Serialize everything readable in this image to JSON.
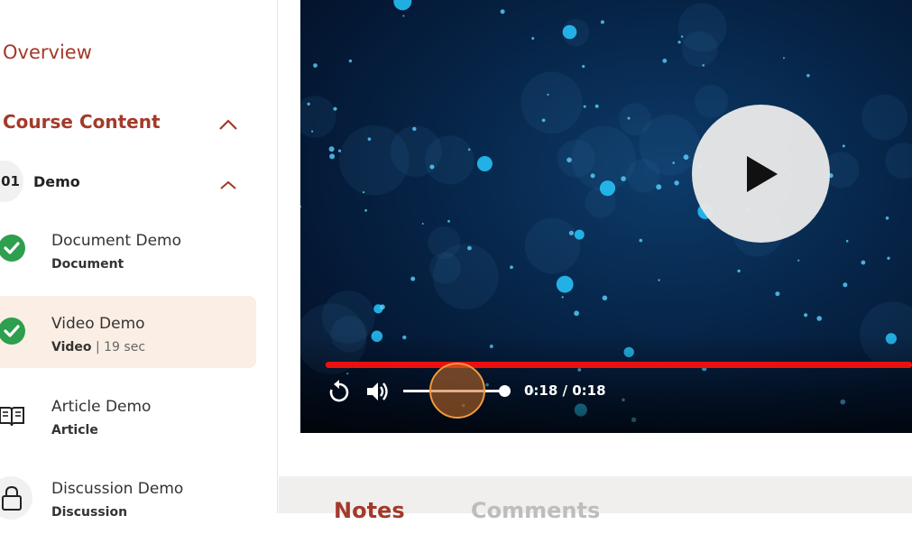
{
  "sidebar": {
    "overview_label": "Overview",
    "course_content_label": "Course Content",
    "module": {
      "number": "01",
      "title": "Demo"
    },
    "lessons": [
      {
        "title": "Document Demo",
        "type": "Document",
        "duration": "",
        "status": "completed",
        "icon": "check-circle-icon"
      },
      {
        "title": "Video Demo",
        "type": "Video",
        "duration": "| 19 sec",
        "status": "completed",
        "icon": "check-circle-icon"
      },
      {
        "title": "Article Demo",
        "type": "Article",
        "duration": "",
        "status": "not-started",
        "icon": "open-book-icon"
      },
      {
        "title": "Discussion Demo",
        "type": "Discussion",
        "duration": "",
        "status": "locked",
        "icon": "lock-icon"
      }
    ]
  },
  "player": {
    "time": "0:18 / 0:18",
    "progress": 1.0,
    "volume": 1.0,
    "icons": [
      "replay-icon",
      "volume-icon",
      "play-icon"
    ]
  },
  "tabs": [
    {
      "label": "Notes",
      "active": true
    },
    {
      "label": "Comments",
      "active": false
    }
  ],
  "colors": {
    "accent": "#a33a2a",
    "success": "#2e9e4f",
    "active_row": "#fbeee4",
    "progress": "#e8110f",
    "tab_inactive": "#bdbdbd"
  }
}
